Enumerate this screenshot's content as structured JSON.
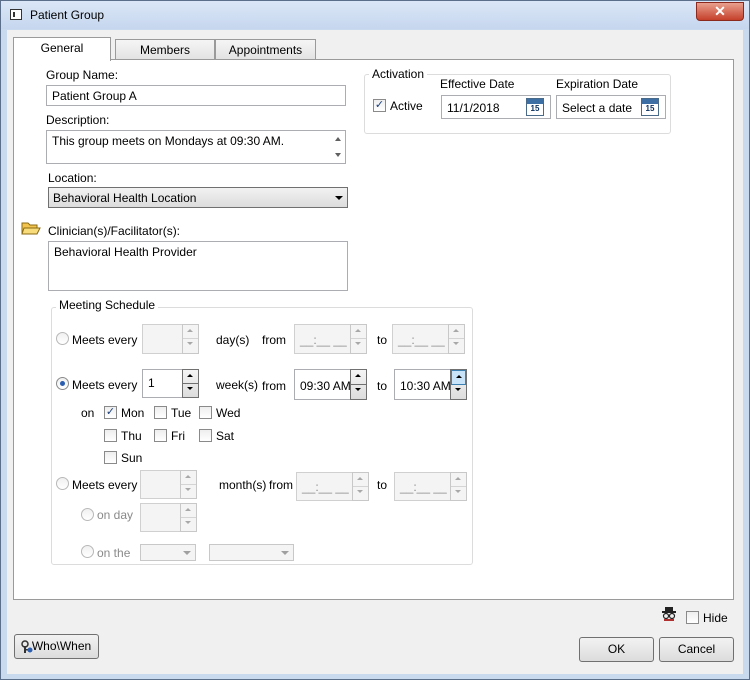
{
  "window": {
    "title": "Patient Group",
    "close_label": "✕"
  },
  "tabs": [
    {
      "label": "General",
      "active": true
    },
    {
      "label": "Members",
      "active": false
    },
    {
      "label": "Appointments",
      "active": false
    }
  ],
  "general": {
    "group_name_label": "Group Name:",
    "group_name_value": "Patient Group A",
    "description_label": "Description:",
    "description_value": "This group meets on Mondays at 09:30 AM.",
    "location_label": "Location:",
    "location_value": "Behavioral Health Location",
    "clinicians_label": "Clinician(s)/Facilitator(s):",
    "clinicians_value": "Behavioral Health Provider"
  },
  "activation": {
    "title": "Activation",
    "active_label": "Active",
    "active_checked": true,
    "effective_date_label": "Effective Date",
    "effective_date_value": "11/1/2018",
    "expiration_date_label": "Expiration Date",
    "expiration_date_placeholder": "Select a date",
    "calendar_day": "15"
  },
  "schedule": {
    "title": "Meeting Schedule",
    "meets_every_label": "Meets every",
    "daily": {
      "unit_label": "day(s)",
      "from_label": "from",
      "to_label": "to",
      "from_value": "__:__ __",
      "to_value": "__:__ __"
    },
    "weekly": {
      "selected": true,
      "interval": "1",
      "unit_label": "week(s)",
      "from_label": "from",
      "to_label": "to",
      "from_value": "09:30 AM",
      "to_value": "10:30 AM",
      "on_label": "on",
      "days": [
        {
          "label": "Mon",
          "checked": true
        },
        {
          "label": "Tue",
          "checked": false
        },
        {
          "label": "Wed",
          "checked": false
        },
        {
          "label": "Thu",
          "checked": false
        },
        {
          "label": "Fri",
          "checked": false
        },
        {
          "label": "Sat",
          "checked": false
        },
        {
          "label": "Sun",
          "checked": false
        }
      ]
    },
    "monthly": {
      "unit_label": "month(s)",
      "from_label": "from",
      "to_label": "to",
      "from_value": "__:__ __",
      "to_value": "__:__ __",
      "on_day_label": "on day",
      "on_the_label": "on the"
    }
  },
  "footer": {
    "hide_label": "Hide",
    "who_when_label": "Who\\When",
    "ok_label": "OK",
    "cancel_label": "Cancel"
  }
}
